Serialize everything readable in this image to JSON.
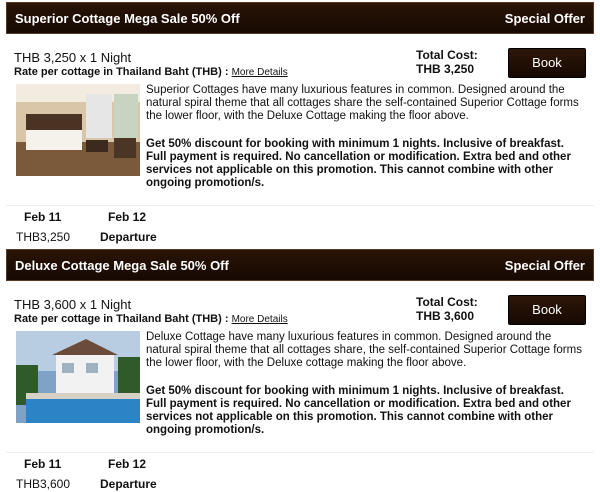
{
  "offers": [
    {
      "title": "Superior Cottage Mega Sale 50% Off",
      "badge": "Special Offer",
      "price_line": "THB 3,250 x 1 Night",
      "rate_label": "Rate per cottage in Thailand Baht (THB) :",
      "more_details": "More Details",
      "total_label": "Total Cost:",
      "total_value": "THB 3,250",
      "book_label": "Book",
      "description": "Superior Cottages have many luxurious features in common. Designed around the natural spiral theme that all cottages share the self-contained Superior Cottage forms the lower floor, with the Deluxe Cottage making the floor above.",
      "promo": "Get 50% discount for booking with minimum 1 nights. Inclusive of breakfast. Full payment is required. No cancellation or modification. Extra bed and other services not applicable on this promotion. This cannot combine with other ongoing promotion/s.",
      "arrival_date": "Feb 11",
      "departure_date": "Feb 12",
      "night_amount": "THB3,250",
      "departure_label": "Departure"
    },
    {
      "title": "Deluxe Cottage Mega Sale 50% Off",
      "badge": "Special Offer",
      "price_line": "THB 3,600 x 1 Night",
      "rate_label": "Rate per cottage in Thailand Baht (THB) :",
      "more_details": "More Details",
      "total_label": "Total Cost:",
      "total_value": "THB 3,600",
      "book_label": "Book",
      "description": "Deluxe Cottage have many luxurious features in common. Designed around the natural spiral theme that all cottages share, the self-contained Superior Cottage forms the lower floor, with the Deluxe cottage making the floor above.",
      "promo": "Get 50% discount for booking with minimum 1 nights. Inclusive of breakfast. Full payment is required. No cancellation or modification. Extra bed and other services not applicable on this promotion. This cannot combine with other ongoing promotion/s.",
      "arrival_date": "Feb 11",
      "departure_date": "Feb 12",
      "night_amount": "THB3,600",
      "departure_label": "Departure"
    }
  ]
}
